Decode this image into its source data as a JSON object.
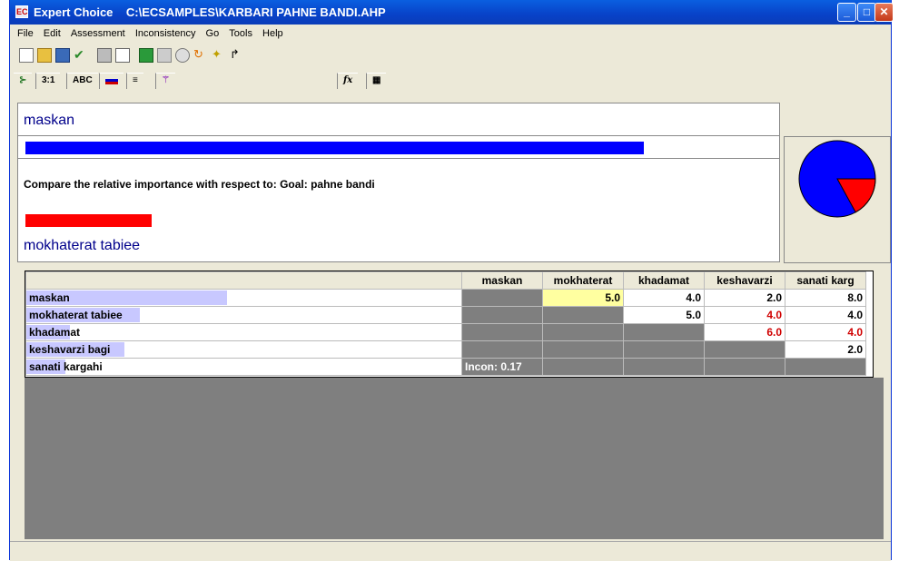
{
  "window": {
    "app_name": "Expert Choice",
    "file_path": "C:\\ECSAMPLES\\KARBARI PAHNE BANDI.AHP"
  },
  "menu": [
    "File",
    "Edit",
    "Assessment",
    "Inconsistency",
    "Go",
    "Tools",
    "Help"
  ],
  "tabs": [
    "3:1",
    "ABC",
    "fx"
  ],
  "compare_panel": {
    "item_a": "maskan",
    "item_b": "mokhaterat tabiee",
    "prompt": "Compare the relative importance with respect to: Goal: pahne bandi",
    "bar_a_fraction": 0.83,
    "bar_b_fraction": 0.17,
    "colors": {
      "item_a": "#0000ff",
      "item_b": "#ff0000"
    }
  },
  "matrix": {
    "columns": [
      "maskan",
      "mokhaterat",
      "khadamat",
      "keshavarzi",
      "sanati karg"
    ],
    "rows": [
      "maskan",
      "mokhaterat tabiee",
      "khadamat",
      "keshavarzi bagi",
      "sanati kargahi"
    ],
    "row_shade_fractions": [
      0.92,
      0.52,
      0.2,
      0.45,
      0.18
    ],
    "cells": [
      [
        "",
        "5.0",
        "4.0",
        "2.0",
        "8.0"
      ],
      [
        "",
        "",
        "5.0",
        "4.0",
        "4.0"
      ],
      [
        "",
        "",
        "",
        "6.0",
        "4.0"
      ],
      [
        "",
        "",
        "",
        "",
        "2.0"
      ],
      [
        "",
        "",
        "",
        "",
        ""
      ]
    ],
    "red_cells": [
      [
        1,
        3
      ],
      [
        2,
        3
      ],
      [
        2,
        4
      ]
    ],
    "inconsistency": "Incon: 0.17"
  }
}
